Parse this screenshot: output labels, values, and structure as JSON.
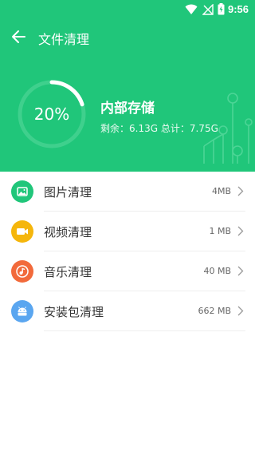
{
  "status_bar": {
    "time": "9:56"
  },
  "toolbar": {
    "title": "文件清理"
  },
  "storage": {
    "percent_label": "20%",
    "used_fraction": 0.2,
    "title": "内部存储",
    "remaining_label": "剩余：6.13G",
    "total_label": "总计：7.75G"
  },
  "items": [
    {
      "label": "图片清理",
      "size": "4MB",
      "icon": "image-icon",
      "color": "#20c67a"
    },
    {
      "label": "视频清理",
      "size": "1 MB",
      "icon": "video-icon",
      "color": "#f5b60c"
    },
    {
      "label": "音乐清理",
      "size": "40 MB",
      "icon": "music-icon",
      "color": "#f26a3b"
    },
    {
      "label": "安装包清理",
      "size": "662 MB",
      "icon": "android-icon",
      "color": "#5aa6f0"
    }
  ]
}
